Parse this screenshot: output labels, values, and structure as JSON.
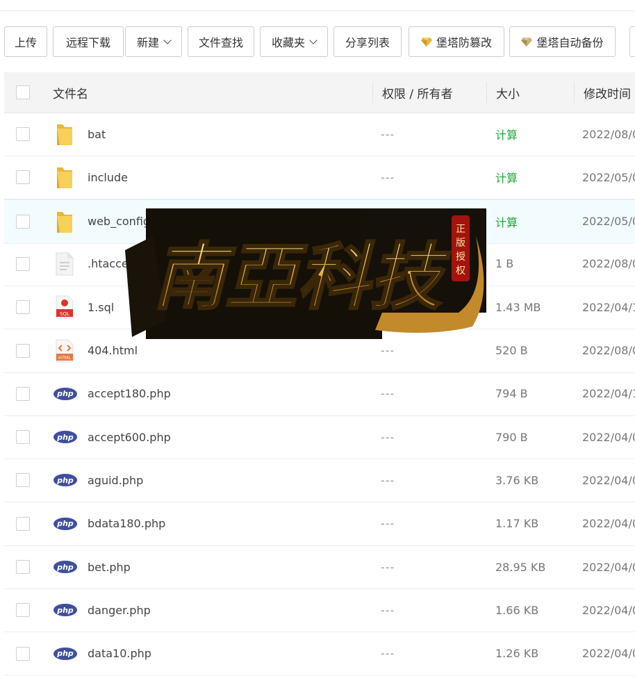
{
  "toolbar": {
    "buttons": [
      {
        "label": "上传"
      },
      {
        "label": "远程下载"
      },
      {
        "label": "新建"
      },
      {
        "label": "文件查找"
      },
      {
        "label": "收藏夹"
      },
      {
        "label": "分享列表"
      },
      {
        "label": "堡塔防篡改"
      },
      {
        "label": "堡塔自动备份"
      }
    ]
  },
  "table": {
    "headers": {
      "name": "文件名",
      "perm": "权限 / 所有者",
      "size": "大小",
      "mtime": "修改时间"
    },
    "rows": [
      {
        "name": "bat",
        "perm": "---",
        "size": "计算",
        "date": "2022/08/0",
        "icon": "folder-icon"
      },
      {
        "name": "include",
        "perm": "---",
        "size": "计算",
        "date": "2022/05/0",
        "icon": "folder-icon"
      },
      {
        "name": "web_config",
        "perm": "---",
        "size": "计算",
        "date": "2022/05/0",
        "icon": "folder-icon"
      },
      {
        "name": ".htaccess",
        "perm": "---",
        "size": "1 B",
        "date": "2022/08/0",
        "icon": "text-file-icon"
      },
      {
        "name": "1.sql",
        "perm": "---",
        "size": "1.43 MB",
        "date": "2022/04/1",
        "icon": "sql-file-icon"
      },
      {
        "name": "404.html",
        "perm": "---",
        "size": "520 B",
        "date": "2022/08/0",
        "icon": "html-file-icon"
      },
      {
        "name": "accept180.php",
        "perm": "---",
        "size": "794 B",
        "date": "2022/04/1",
        "icon": "php-file-icon"
      },
      {
        "name": "accept600.php",
        "perm": "---",
        "size": "790 B",
        "date": "2022/04/0",
        "icon": "php-file-icon"
      },
      {
        "name": "aguid.php",
        "perm": "---",
        "size": "3.76 KB",
        "date": "2022/04/0",
        "icon": "php-file-icon"
      },
      {
        "name": "bdata180.php",
        "perm": "---",
        "size": "1.17 KB",
        "date": "2022/04/0",
        "icon": "php-file-icon"
      },
      {
        "name": "bet.php",
        "perm": "---",
        "size": "28.95 KB",
        "date": "2022/04/0",
        "icon": "php-file-icon"
      },
      {
        "name": "danger.php",
        "perm": "---",
        "size": "1.66 KB",
        "date": "2022/04/0",
        "icon": "php-file-icon"
      },
      {
        "name": "data10.php",
        "perm": "---",
        "size": "1.26 KB",
        "date": "2022/04/0",
        "icon": "php-file-icon"
      }
    ]
  },
  "icons": {
    "php_label": "php",
    "sql_label": "SQL",
    "html_label": "HTML"
  },
  "watermark": {
    "text": "南亞科技",
    "seal": "正版授权"
  },
  "colors": {
    "calc_green": "#20a53a",
    "folder_yellow": "#f5c94a",
    "php_blue": "#3f4f9c",
    "header_bg": "#f4f4f4",
    "highlight_row": "#f2fbfd"
  }
}
